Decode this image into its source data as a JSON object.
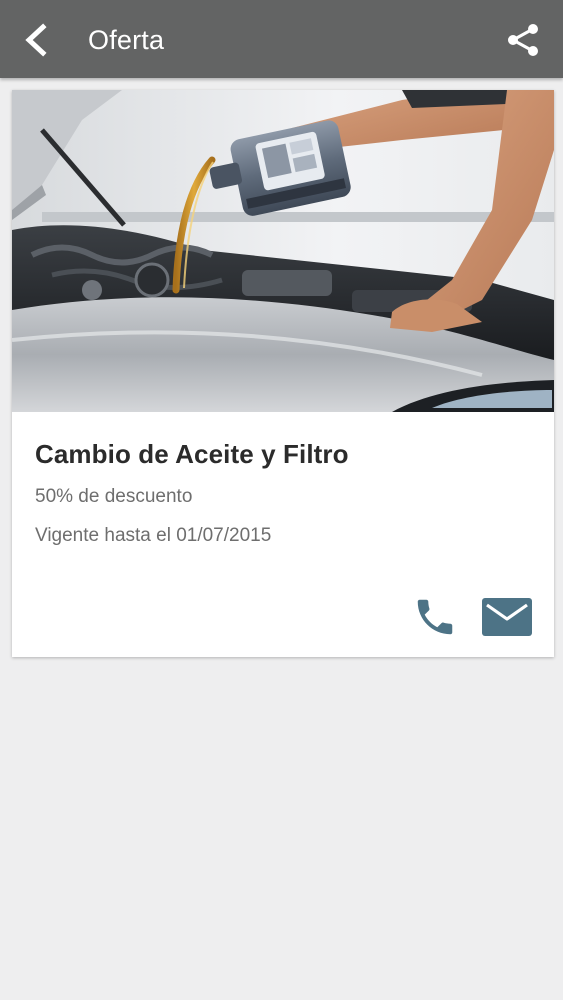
{
  "header": {
    "title": "Oferta",
    "back_icon": "chevron-left-icon",
    "share_icon": "share-icon"
  },
  "offer": {
    "image": "oil-change-photo",
    "title": "Cambio de Aceite y Filtro",
    "discount": "50% de descuento",
    "validity": "Vigente hasta el 01/07/2015",
    "actions": {
      "phone_icon": "phone-icon",
      "email_icon": "email-icon"
    }
  },
  "colors": {
    "appbar": "#636464",
    "background": "#eeeeef",
    "action_icons": "#4d7386",
    "title_text": "#2b2b2b",
    "secondary_text": "#6e6e6e"
  }
}
